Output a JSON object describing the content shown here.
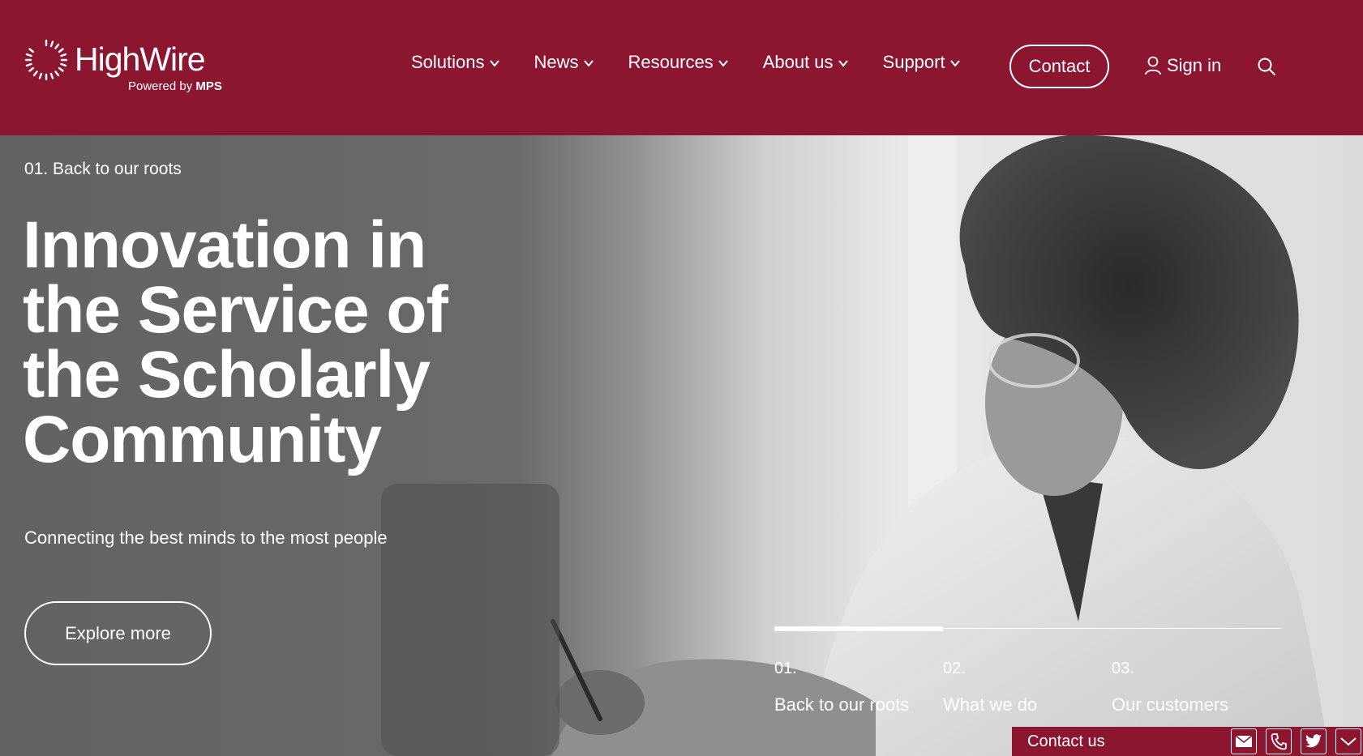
{
  "header": {
    "brand": "HighWire",
    "powered_prefix": "Powered by",
    "powered_brand": "MPS",
    "nav": [
      {
        "label": "Solutions"
      },
      {
        "label": "News"
      },
      {
        "label": "Resources"
      },
      {
        "label": "About us"
      },
      {
        "label": "Support"
      }
    ],
    "contact_label": "Contact",
    "signin_label": "Sign in"
  },
  "hero": {
    "eyebrow": "01. Back to our roots",
    "headline": "Innovation in the Service of the Scholarly Community",
    "subline": "Connecting the best minds to the most people",
    "cta_label": "Explore more",
    "progress": 0.333
  },
  "slides": [
    {
      "num": "01.",
      "label": "Back to our roots"
    },
    {
      "num": "02.",
      "label": "What we do"
    },
    {
      "num": "03.",
      "label": "Our customers"
    }
  ],
  "contact_bar": {
    "label": "Contact us",
    "icons": [
      "mail-icon",
      "phone-icon",
      "twitter-icon",
      "chevron-down-icon"
    ]
  },
  "colors": {
    "brand": "#8c1530",
    "text": "#ffffff"
  }
}
